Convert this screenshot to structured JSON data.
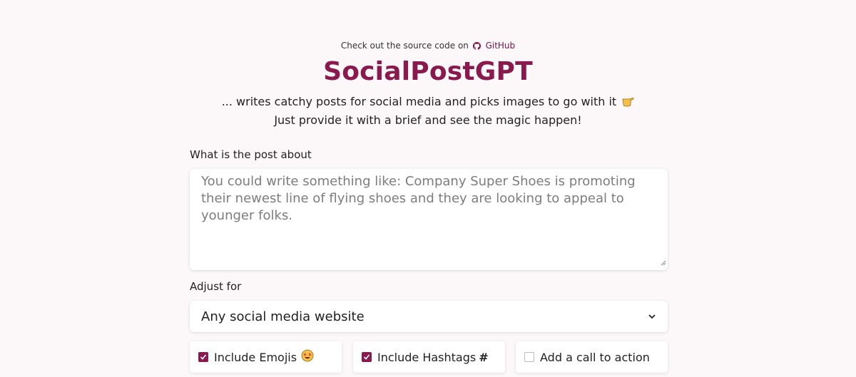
{
  "header": {
    "note_text": "Check out the source code on",
    "github_link": "GitHub",
    "github_icon": "github-icon"
  },
  "title": "SocialPostGPT",
  "tagline": {
    "line1": "... writes catchy posts for social media and picks images to go with it",
    "line1_icon": "pointing-hand-icon",
    "line2": "Just provide it with a brief and see the magic happen!"
  },
  "form": {
    "brief_label": "What is the post about",
    "brief_value": "",
    "brief_placeholder": "You could write something like: Company Super Shoes is promoting their newest line of flying shoes and they are looking to appeal to younger folks.",
    "adjust_label": "Adjust for",
    "platform_selected": "Any social media website",
    "options": [
      {
        "label": "Include Emojis",
        "checked": true,
        "suffix_icon": "star-struck-emoji-icon"
      },
      {
        "label": "Include Hashtags",
        "checked": true,
        "suffix": "#"
      },
      {
        "label": "Add a call to action",
        "checked": false
      }
    ]
  },
  "colors": {
    "brand": "#8a1a4e",
    "background": "#fcf7f8"
  }
}
